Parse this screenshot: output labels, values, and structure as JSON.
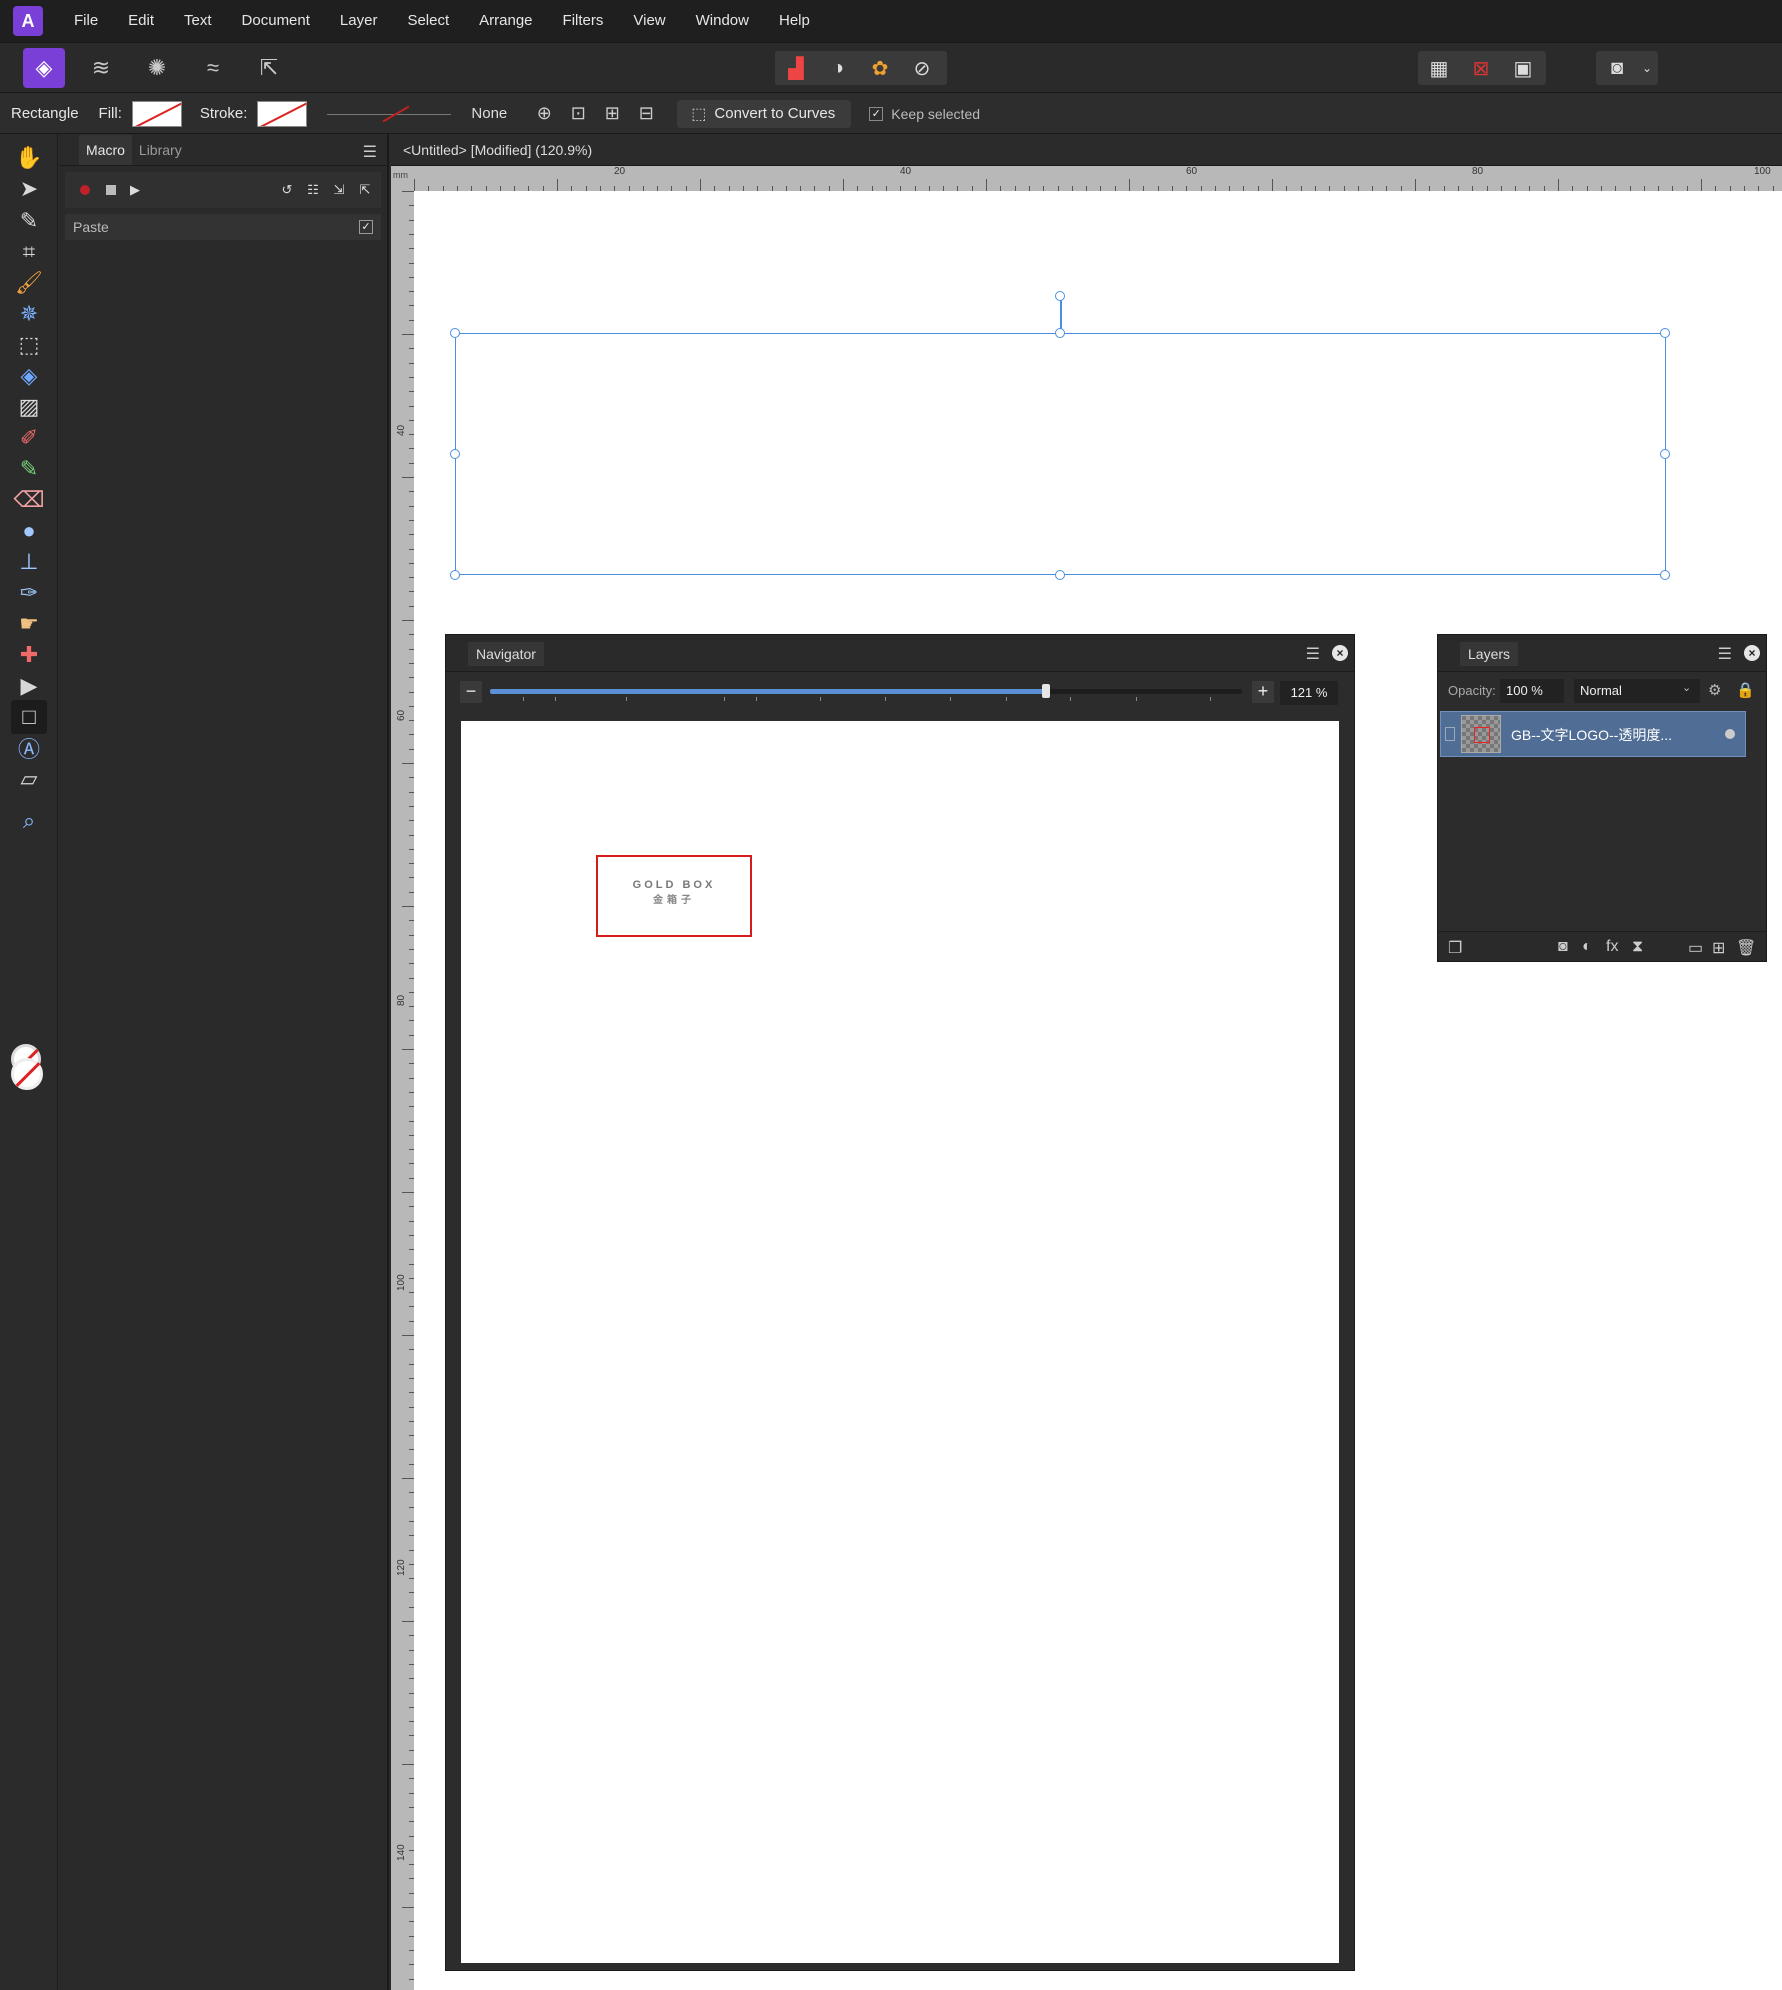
{
  "app": {
    "logo_icon": "affinity-photo-icon"
  },
  "menu": [
    "File",
    "Edit",
    "Text",
    "Document",
    "Layer",
    "Select",
    "Arrange",
    "Filters",
    "View",
    "Window",
    "Help"
  ],
  "context_bar": {
    "tool_name": "Rectangle",
    "fill_label": "Fill:",
    "stroke_label": "Stroke:",
    "stroke_width": "None",
    "convert_label": "Convert to Curves",
    "keep_selected_label": "Keep selected",
    "keep_selected_checked": true
  },
  "macro_panel": {
    "tabs": [
      "Macro",
      "Library"
    ],
    "active_tab": "Macro",
    "actions": [
      {
        "label": "Paste",
        "enabled": true
      }
    ]
  },
  "document": {
    "tab_title": "<Untitled> [Modified] (120.9%)",
    "ruler_unit": "mm",
    "h_ruler_labels": [
      "20",
      "40",
      "60",
      "80",
      "100"
    ],
    "v_ruler_labels": [
      "40",
      "60",
      "80",
      "100",
      "120",
      "140"
    ]
  },
  "navigator": {
    "title": "Navigator",
    "zoom": "121 %",
    "zoom_fraction": 0.74,
    "preview_text_line1": "GOLD BOX",
    "preview_text_line2": "金箱子"
  },
  "layers": {
    "title": "Layers",
    "opacity_label": "Opacity:",
    "opacity_value": "100 %",
    "blend_mode": "Normal",
    "items": [
      {
        "name": "GB--文字LOGO--透明度...",
        "selected": true
      }
    ]
  },
  "colors": {
    "accent": "#7a3fd6",
    "selection": "#4a90e2",
    "layer_selected": "#4f6d95",
    "logo_red": "#d41c1c"
  }
}
